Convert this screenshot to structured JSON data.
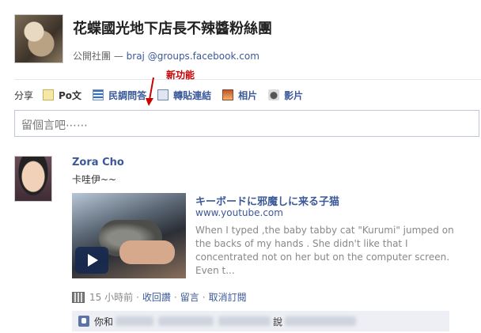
{
  "group": {
    "title": "花蝶國光地下店長不辣醬粉絲團",
    "type_label": "公開社團",
    "separator": " — ",
    "email": "braj @groups.facebook.com"
  },
  "annotation": {
    "label": "新功能",
    "color": "#cc0000"
  },
  "share_bar": {
    "label": "分享",
    "items": [
      {
        "label": "Po文",
        "icon": "post-icon",
        "active": true
      },
      {
        "label": "民調問答",
        "icon": "poll-icon"
      },
      {
        "label": "轉貼連結",
        "icon": "link-icon"
      },
      {
        "label": "相片",
        "icon": "photo-icon"
      },
      {
        "label": "影片",
        "icon": "video-icon"
      }
    ]
  },
  "comment_box": {
    "placeholder": "留個言吧⋯⋯"
  },
  "post": {
    "author": "Zora Cho",
    "message": "卡哇伊~~",
    "link": {
      "title": "キーボードに邪魔しに来る子猫",
      "domain": "www.youtube.com",
      "description": "When I typed ,the baby tabby cat \"Kurumi\" jumped on the backs of my hands . She didn't like that I concentrated not on her but on the computer screen. Even t..."
    },
    "meta": {
      "time": "15 小時前",
      "actions": [
        "收回讚",
        "留言",
        "取消訂閱"
      ]
    },
    "likes": {
      "prefix": "你和",
      "suffix": "說"
    }
  },
  "colors": {
    "link": "#3b5998",
    "likes_bg": "#edeff4"
  }
}
